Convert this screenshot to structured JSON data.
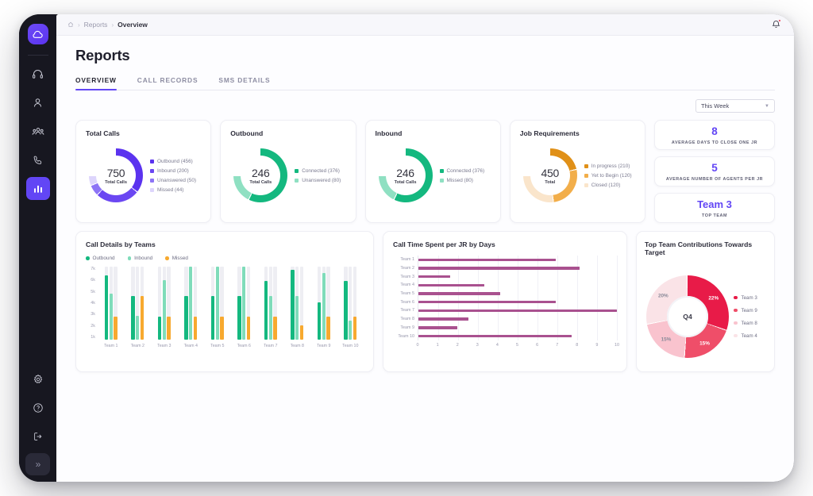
{
  "sidebar": {
    "logo_icon": "cloud-logo-icon",
    "items": [
      {
        "icon": "headset-icon",
        "active": false
      },
      {
        "icon": "person-icon",
        "active": false
      },
      {
        "icon": "people-group-icon",
        "active": false
      },
      {
        "icon": "phone-icon",
        "active": false
      },
      {
        "icon": "bar-chart-icon",
        "active": true
      }
    ],
    "bottom_items": [
      {
        "icon": "gear-icon"
      },
      {
        "icon": "help-circle-icon"
      },
      {
        "icon": "logout-icon"
      }
    ],
    "expand_label": "»"
  },
  "breadcrumb": {
    "home_icon": "home-icon",
    "separator": "›",
    "items": [
      "Reports",
      "Overview"
    ],
    "bell_icon": "bell-icon"
  },
  "header": {
    "title": "Reports"
  },
  "tabs": [
    {
      "label": "OVERVIEW",
      "active": true
    },
    {
      "label": "CALL RECORDS",
      "active": false
    },
    {
      "label": "SMS DETAILS",
      "active": false
    }
  ],
  "filter": {
    "selected": "This Week",
    "caret_icon": "chevron-down-icon"
  },
  "donut_cards": [
    {
      "title": "Total Calls",
      "center_value": "750",
      "center_label": "Total Calls",
      "legend": [
        {
          "label": "Outbound (456)",
          "color": "#5b33ef"
        },
        {
          "label": "Inbound (200)",
          "color": "#6b47f2"
        },
        {
          "label": "Unanswered (50)",
          "color": "#8d74f6"
        },
        {
          "label": "Missed (44)",
          "color": "#ddd5fc"
        }
      ]
    },
    {
      "title": "Outbound",
      "center_value": "246",
      "center_label": "Total Calls",
      "legend": [
        {
          "label": "Connected (376)",
          "color": "#14b87f"
        },
        {
          "label": "Unanswered (80)",
          "color": "#8fe0c2"
        }
      ]
    },
    {
      "title": "Inbound",
      "center_value": "246",
      "center_label": "Total Calls",
      "legend": [
        {
          "label": "Connected (376)",
          "color": "#14b87f"
        },
        {
          "label": "Missed (80)",
          "color": "#8fe0c2"
        }
      ]
    },
    {
      "title": "Job Requirements",
      "center_value": "450",
      "center_label": "Total",
      "legend": [
        {
          "label": "In progress (210)",
          "color": "#e09018"
        },
        {
          "label": "Yet to Begin (120)",
          "color": "#f2ae4a"
        },
        {
          "label": "Closed (120)",
          "color": "#fae5cb"
        }
      ]
    }
  ],
  "stat_cards": [
    {
      "value": "8",
      "label": "AVERAGE DAYS TO CLOSE ONE JR"
    },
    {
      "value": "5",
      "label": "AVERAGE NUMBER OF AGENTS PER JR"
    },
    {
      "value": "Team 3",
      "label": "TOP TEAM"
    }
  ],
  "chart_data": [
    {
      "type": "bar",
      "title": "Call Details by Teams",
      "xlabel": "",
      "ylabel": "",
      "ylim": [
        0,
        7
      ],
      "yticks": [
        "1k",
        "2k",
        "3k",
        "4k",
        "5k",
        "6k",
        "7k"
      ],
      "grid": false,
      "legend_position": "top-left",
      "categories": [
        "Team 1",
        "Team 2",
        "Team 3",
        "Team 4",
        "Team 5",
        "Team 6",
        "Team 7",
        "Team 8",
        "Team 9",
        "Team 10"
      ],
      "series": [
        {
          "name": "Outbound",
          "color": "#14b87f",
          "values": [
            6.2,
            4.2,
            2.2,
            4.2,
            4.2,
            4.2,
            5.6,
            6.7,
            3.6,
            5.6
          ]
        },
        {
          "name": "Inbound",
          "color": "#7fdcba",
          "values": [
            4.4,
            2.3,
            5.7,
            7.0,
            7.0,
            7.0,
            4.2,
            4.2,
            6.4,
            1.85
          ]
        },
        {
          "name": "Missed",
          "color": "#f7a92f",
          "values": [
            2.2,
            4.2,
            2.2,
            2.2,
            2.2,
            2.2,
            2.2,
            1.4,
            2.2,
            2.2
          ]
        }
      ]
    },
    {
      "type": "bar",
      "orientation": "horizontal",
      "title": "Call Time Spent per JR by Days",
      "xlabel": "",
      "ylabel": "",
      "xlim": [
        0,
        10
      ],
      "xticks": [
        "0",
        "1",
        "2",
        "3",
        "4",
        "5",
        "6",
        "7",
        "8",
        "9",
        "10"
      ],
      "grid": true,
      "bar_color": "#a9518f",
      "categories": [
        "Team 1",
        "Team 2",
        "Team 3",
        "Team 4",
        "Team 5",
        "Team 6",
        "Team 7",
        "Team 8",
        "Team 9",
        "Team 10"
      ],
      "values": [
        6.9,
        8.1,
        1.6,
        3.3,
        4.1,
        6.9,
        10.0,
        2.5,
        1.95,
        7.7
      ]
    },
    {
      "type": "pie",
      "title": "Top Team Contributions Towards Target",
      "center_label": "Q4",
      "legend_position": "right",
      "labels": [
        "Team 3",
        "Team 9",
        "Team 8",
        "Team 4"
      ],
      "values": [
        22,
        15,
        15,
        20
      ],
      "display_percents": [
        "22%",
        "15%",
        "15%",
        "20%"
      ],
      "colors": [
        "#e81b48",
        "#ef4e69",
        "#f9c3ce",
        "#fae3e7"
      ]
    }
  ]
}
